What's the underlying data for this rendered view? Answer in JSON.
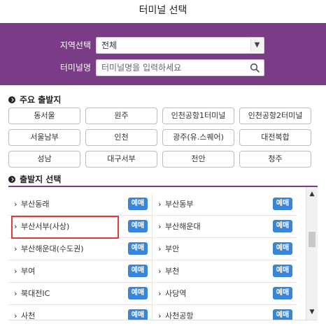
{
  "window": {
    "title": "터미널 선택"
  },
  "search": {
    "region_label": "지역선택",
    "region_value": "전체",
    "terminal_label": "터미널명",
    "terminal_placeholder": "터미널명을 입력하세요"
  },
  "major": {
    "heading": "주요 출발지",
    "items": [
      "동서울",
      "원주",
      "인천공항1터미널",
      "인천공항2터미널",
      "서울남부",
      "인천",
      "광주(유.스퀘어)",
      "대전복합",
      "성남",
      "대구서부",
      "천안",
      "청주"
    ]
  },
  "departures": {
    "heading": "출발지 선택",
    "book_label": "예매",
    "rows": [
      {
        "left": "부산동래",
        "right": "부산동부"
      },
      {
        "left": "부산서부(사상)",
        "right": "부산해운대"
      },
      {
        "left": "부산해운대(수도권)",
        "right": "부안"
      },
      {
        "left": "부여",
        "right": "부천"
      },
      {
        "left": "북대전IC",
        "right": "사당역"
      },
      {
        "left": "사천",
        "right": "사천공항"
      }
    ]
  },
  "icons": {
    "bullet": "check-circle-icon",
    "search": "search-icon",
    "arrow": "chevron-down-icon"
  },
  "colors": {
    "panel": "#7a3c86",
    "book_button": "#3a86d6",
    "highlight": "#e23a3a"
  }
}
